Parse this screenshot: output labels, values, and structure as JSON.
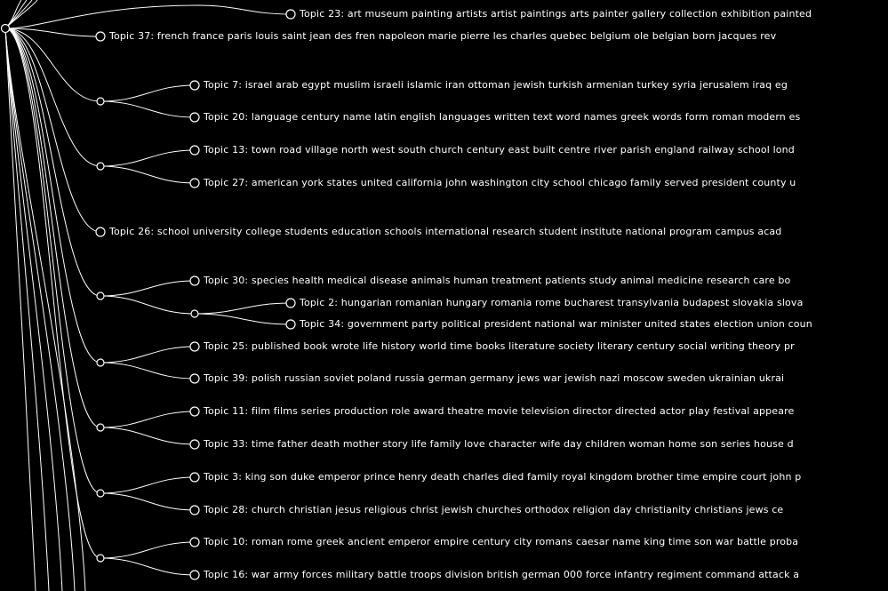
{
  "colors": {
    "background": "#000000",
    "line": "#ffffff",
    "text": "#ffffff"
  },
  "leaves": [
    {
      "id": "t23",
      "label": "Topic 23: art museum painting artists artist paintings arts painter gallery collection exhibition painted"
    },
    {
      "id": "t37",
      "label": "Topic 37: french france paris louis saint jean des fren napoleon marie pierre les charles quebec belgium ole belgian born jacques rev"
    },
    {
      "id": "t7",
      "label": "Topic 7: israel arab egypt muslim israeli islamic iran ottoman jewish turkish armenian turkey syria jerusalem iraq eg"
    },
    {
      "id": "t20",
      "label": "Topic 20: language century name latin english languages written text word names greek words form roman modern es"
    },
    {
      "id": "t13",
      "label": "Topic 13: town road village north west south church century east built centre river parish england railway school lond"
    },
    {
      "id": "t27",
      "label": "Topic 27: american york states united california john washington city school chicago family served president county u"
    },
    {
      "id": "t26",
      "label": "Topic 26: school university college students education schools international research student institute national program campus acad"
    },
    {
      "id": "t30",
      "label": "Topic 30: species health medical disease animals human treatment patients study animal medicine research care bo"
    },
    {
      "id": "t2",
      "label": "Topic 2: hungarian romanian hungary romania rome bucharest transylvania budapest slovakia slova"
    },
    {
      "id": "t34",
      "label": "Topic 34: government party political president national war minister united states election union coun"
    },
    {
      "id": "t25",
      "label": "Topic 25: published book wrote life history world time books literature society literary century social writing theory pr"
    },
    {
      "id": "t39",
      "label": "Topic 39: polish russian soviet poland russia german germany jews war jewish nazi moscow sweden ukrainian ukrai"
    },
    {
      "id": "t11",
      "label": "Topic 11: film films series production role award theatre movie television director directed actor play festival appeare"
    },
    {
      "id": "t33",
      "label": "Topic 33: time father death mother story life family love character wife day children woman home son series house d"
    },
    {
      "id": "t3",
      "label": "Topic 3: king son duke emperor prince henry death charles died family royal kingdom brother time empire court john p"
    },
    {
      "id": "t28",
      "label": "Topic 28: church christian jesus religious christ jewish churches orthodox religion day christianity christians jews ce"
    },
    {
      "id": "t10",
      "label": "Topic 10: roman rome greek ancient emperor empire century city romans caesar name king time son war battle proba"
    },
    {
      "id": "t16",
      "label": "Topic 16: war army forces military battle troops division british german 000 force infantry regiment command attack a"
    }
  ]
}
